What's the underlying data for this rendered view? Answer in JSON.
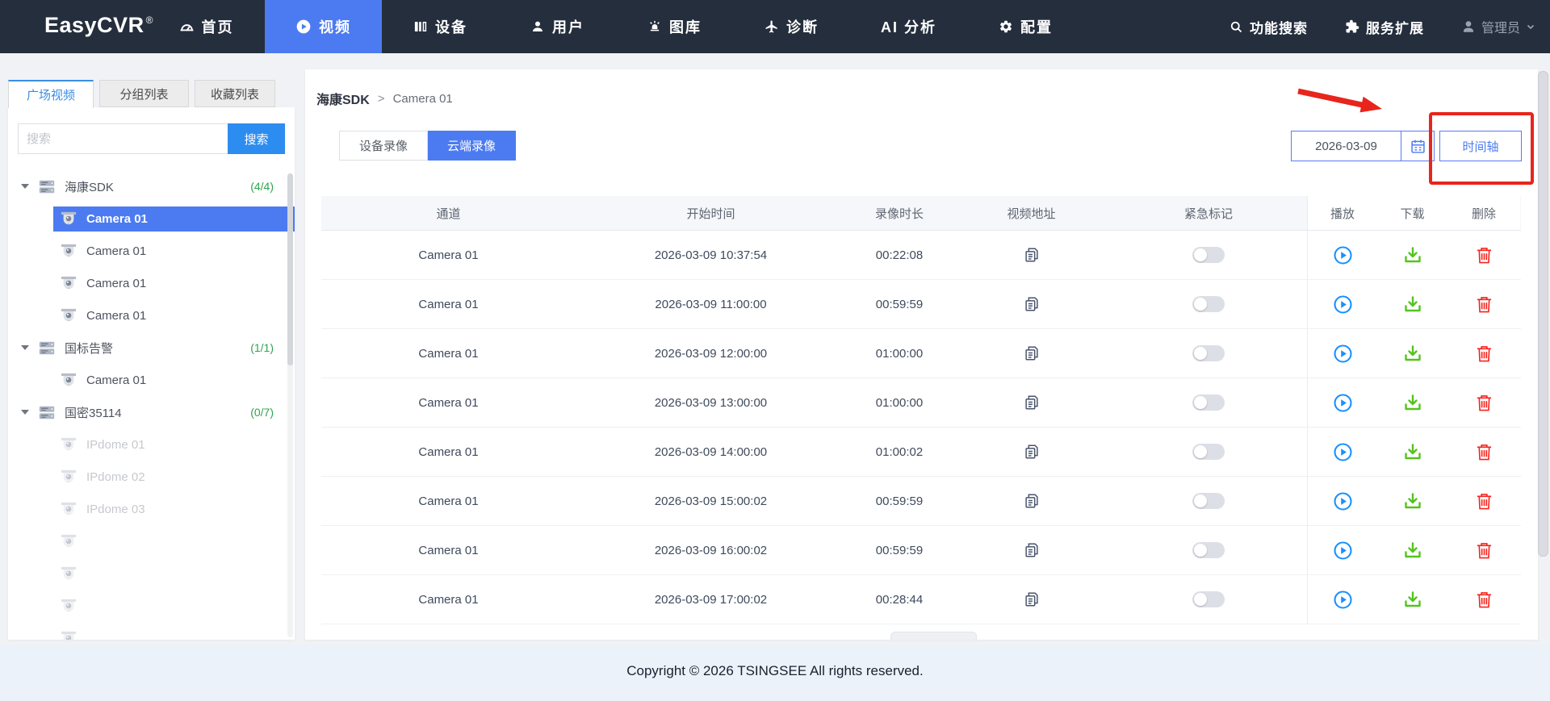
{
  "navbar": {
    "logo": "EasyCVR",
    "logo_reg": "®",
    "items": [
      {
        "key": "home",
        "label": "首页",
        "icon": "dashboard-icon",
        "active": false
      },
      {
        "key": "video",
        "label": "视频",
        "icon": "video-icon",
        "active": true
      },
      {
        "key": "device",
        "label": "设备",
        "icon": "device-icon",
        "active": false
      },
      {
        "key": "user",
        "label": "用户",
        "icon": "user-icon",
        "active": false
      },
      {
        "key": "gallery",
        "label": "图库",
        "icon": "gallery-icon",
        "active": false
      },
      {
        "key": "diagnosis",
        "label": "诊断",
        "icon": "diagnosis-icon",
        "active": false
      },
      {
        "key": "ai-analysis",
        "label": "AI 分析",
        "icon": null,
        "active": false
      },
      {
        "key": "config",
        "label": "配置",
        "icon": "gear-icon",
        "active": false
      }
    ],
    "search_label": "功能搜索",
    "extension_label": "服务扩展",
    "admin_label": "管理员"
  },
  "sidebar": {
    "tabs": [
      {
        "label": "广场视频",
        "active": true
      },
      {
        "label": "分组列表",
        "active": false
      },
      {
        "label": "收藏列表",
        "active": false
      }
    ],
    "search_placeholder": "搜索",
    "search_button": "搜索",
    "tree": [
      {
        "label": "海康SDK",
        "count": "(4/4)",
        "children": [
          {
            "label": "Camera 01",
            "selected": true,
            "disabled": false
          },
          {
            "label": "Camera 01",
            "selected": false,
            "disabled": false
          },
          {
            "label": "Camera 01",
            "selected": false,
            "disabled": false
          },
          {
            "label": "Camera 01",
            "selected": false,
            "disabled": false
          }
        ]
      },
      {
        "label": "国标告警",
        "count": "(1/1)",
        "children": [
          {
            "label": "Camera 01",
            "selected": false,
            "disabled": false
          }
        ]
      },
      {
        "label": "国密35114",
        "count": "(0/7)",
        "children": [
          {
            "label": "IPdome 01",
            "selected": false,
            "disabled": true
          },
          {
            "label": "IPdome 02",
            "selected": false,
            "disabled": true
          },
          {
            "label": "IPdome 03",
            "selected": false,
            "disabled": true
          },
          {
            "label": "",
            "selected": false,
            "disabled": true
          },
          {
            "label": "",
            "selected": false,
            "disabled": true
          },
          {
            "label": "",
            "selected": false,
            "disabled": true
          },
          {
            "label": "",
            "selected": false,
            "disabled": true
          }
        ]
      }
    ]
  },
  "main": {
    "breadcrumb": {
      "parent": "海康SDK",
      "separator": ">",
      "current": "Camera 01"
    },
    "record_tabs": [
      {
        "label": "设备录像",
        "active": false
      },
      {
        "label": "云端录像",
        "active": true
      }
    ],
    "date_value": "2026-03-09",
    "timeline_button": "时间轴",
    "table": {
      "columns": [
        "通道",
        "开始时间",
        "录像时长",
        "视频地址",
        "紧急标记",
        "播放",
        "下载",
        "删除"
      ],
      "rows": [
        {
          "channel": "Camera 01",
          "start": "2026-03-09 10:37:54",
          "duration": "00:22:08",
          "emergency": false
        },
        {
          "channel": "Camera 01",
          "start": "2026-03-09 11:00:00",
          "duration": "00:59:59",
          "emergency": false
        },
        {
          "channel": "Camera 01",
          "start": "2026-03-09 12:00:00",
          "duration": "01:00:00",
          "emergency": false
        },
        {
          "channel": "Camera 01",
          "start": "2026-03-09 13:00:00",
          "duration": "01:00:00",
          "emergency": false
        },
        {
          "channel": "Camera 01",
          "start": "2026-03-09 14:00:00",
          "duration": "01:00:02",
          "emergency": false
        },
        {
          "channel": "Camera 01",
          "start": "2026-03-09 15:00:02",
          "duration": "00:59:59",
          "emergency": false
        },
        {
          "channel": "Camera 01",
          "start": "2026-03-09 16:00:02",
          "duration": "00:59:59",
          "emergency": false
        },
        {
          "channel": "Camera 01",
          "start": "2026-03-09 17:00:02",
          "duration": "00:28:44",
          "emergency": false
        }
      ]
    }
  },
  "footer": {
    "copyright": "Copyright © 2026 TSINGSEE All rights reserved."
  },
  "colors": {
    "navbar_bg": "#252e3d",
    "accent_blue": "#4c7bf1",
    "tab_active_blue": "#3a8ee6",
    "search_button_blue": "#2d8cf0",
    "count_green": "#2ea44f",
    "play_blue": "#1890ff",
    "download_green": "#53c41d",
    "delete_red": "#f5231d",
    "annotation_red": "#e8251c"
  }
}
